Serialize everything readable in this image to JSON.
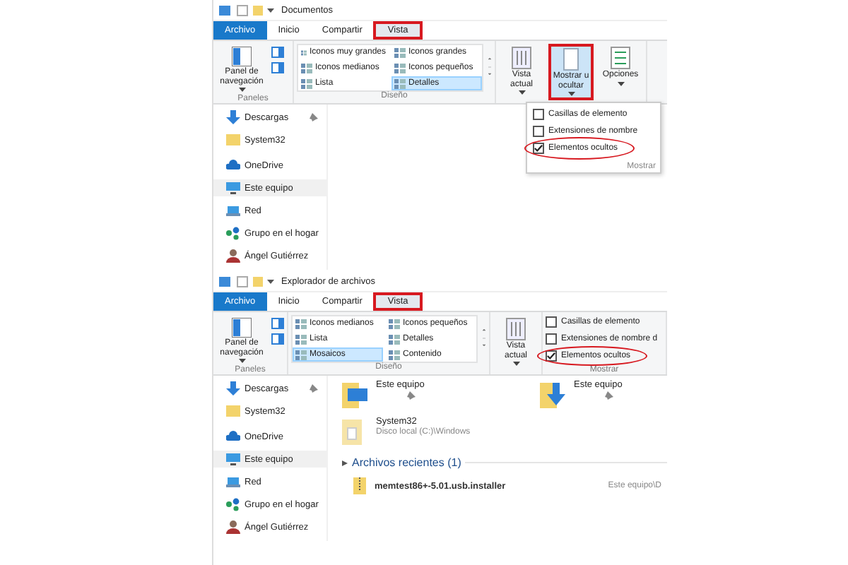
{
  "screens": [
    {
      "title": "Documentos",
      "tabs": [
        {
          "label": "Archivo",
          "kind": "file",
          "selected": false,
          "highlighted": false
        },
        {
          "label": "Inicio",
          "kind": "tab",
          "selected": false,
          "highlighted": false
        },
        {
          "label": "Compartir",
          "kind": "tab",
          "selected": false,
          "highlighted": false
        },
        {
          "label": "Vista",
          "kind": "tab",
          "selected": true,
          "highlighted": true
        }
      ],
      "ribbon": [
        {
          "kind": "panes",
          "label": "Paneles",
          "button": "Panel de navegación"
        },
        {
          "kind": "gallery",
          "label": "Diseño",
          "items": [
            {
              "label": "Iconos muy grandes",
              "selected": false
            },
            {
              "label": "Iconos grandes",
              "selected": false
            },
            {
              "label": "Iconos medianos",
              "selected": false
            },
            {
              "label": "Iconos pequeños",
              "selected": false
            },
            {
              "label": "Lista",
              "selected": false
            },
            {
              "label": "Detalles",
              "selected": true
            }
          ]
        },
        {
          "kind": "buttons",
          "buttons": [
            {
              "label": "Vista actual",
              "kind": "view",
              "pressed": false,
              "highlighted": false
            },
            {
              "label": "Mostrar u ocultar",
              "kind": "showhide",
              "pressed": true,
              "highlighted": true
            },
            {
              "label": "Opciones",
              "kind": "options",
              "pressed": false,
              "highlighted": false
            }
          ]
        }
      ],
      "dropdown": {
        "items": [
          {
            "label": "Casillas de elemento",
            "checked": false,
            "circled": false
          },
          {
            "label": "Extensiones de nombre",
            "checked": false,
            "circled": false
          },
          {
            "label": "Elementos ocultos",
            "checked": true,
            "circled": true
          }
        ],
        "footer": "Mostrar"
      },
      "sidebar": [
        {
          "label": "Descargas",
          "kind": "download",
          "pinned": true,
          "selected": false
        },
        {
          "label": "System32",
          "kind": "folder",
          "pinned": false,
          "selected": false
        },
        {
          "label": "OneDrive",
          "kind": "cloud",
          "pinned": false,
          "selected": false
        },
        {
          "label": "Este equipo",
          "kind": "computer",
          "pinned": false,
          "selected": true
        },
        {
          "label": "Red",
          "kind": "network",
          "pinned": false,
          "selected": false
        },
        {
          "label": "Grupo en el hogar",
          "kind": "homegroup",
          "pinned": false,
          "selected": false
        },
        {
          "label": "Ángel Gutiérrez",
          "kind": "user",
          "pinned": false,
          "selected": false
        }
      ]
    },
    {
      "title": "Explorador de archivos",
      "tabs": [
        {
          "label": "Archivo",
          "kind": "file",
          "selected": false,
          "highlighted": false
        },
        {
          "label": "Inicio",
          "kind": "tab",
          "selected": false,
          "highlighted": false
        },
        {
          "label": "Compartir",
          "kind": "tab",
          "selected": false,
          "highlighted": false
        },
        {
          "label": "Vista",
          "kind": "tab",
          "selected": true,
          "highlighted": true
        }
      ],
      "ribbon": [
        {
          "kind": "panes",
          "label": "Paneles",
          "button": "Panel de navegación"
        },
        {
          "kind": "gallery",
          "label": "Diseño",
          "items": [
            {
              "label": "Iconos medianos",
              "selected": false
            },
            {
              "label": "Iconos pequeños",
              "selected": false
            },
            {
              "label": "Lista",
              "selected": false
            },
            {
              "label": "Detalles",
              "selected": false
            },
            {
              "label": "Mosaicos",
              "selected": true
            },
            {
              "label": "Contenido",
              "selected": false
            }
          ]
        },
        {
          "kind": "buttons",
          "buttons": [
            {
              "label": "Vista actual",
              "kind": "view",
              "pressed": false,
              "highlighted": false
            }
          ]
        },
        {
          "kind": "checklist",
          "label": "Mostrar",
          "items": [
            {
              "label": "Casillas de elemento",
              "checked": false,
              "circled": false
            },
            {
              "label": "Extensiones de nombre d",
              "checked": false,
              "circled": false
            },
            {
              "label": "Elementos ocultos",
              "checked": true,
              "circled": true
            }
          ]
        }
      ],
      "sidebar": [
        {
          "label": "Descargas",
          "kind": "download",
          "pinned": true,
          "selected": false
        },
        {
          "label": "System32",
          "kind": "folder",
          "pinned": false,
          "selected": false
        },
        {
          "label": "OneDrive",
          "kind": "cloud",
          "pinned": false,
          "selected": false
        },
        {
          "label": "Este equipo",
          "kind": "computer",
          "pinned": false,
          "selected": true
        },
        {
          "label": "Red",
          "kind": "network",
          "pinned": false,
          "selected": false
        },
        {
          "label": "Grupo en el hogar",
          "kind": "homegroup",
          "pinned": false,
          "selected": false
        },
        {
          "label": "Ángel Gutiérrez",
          "kind": "user",
          "pinned": false,
          "selected": false
        }
      ],
      "content": {
        "tiles": [
          {
            "label": "Este equipo",
            "kind": "computer",
            "pinned": true
          },
          {
            "label": "Este equipo",
            "kind": "download",
            "pinned": true
          }
        ],
        "folders": [
          {
            "name": "System32",
            "detail": "Disco local (C:)\\Windows"
          }
        ],
        "section": "Archivos recientes (1)",
        "recent": [
          {
            "name": "memtest86+-5.01.usb.installer",
            "location": "Este equipo\\D"
          }
        ]
      }
    }
  ]
}
